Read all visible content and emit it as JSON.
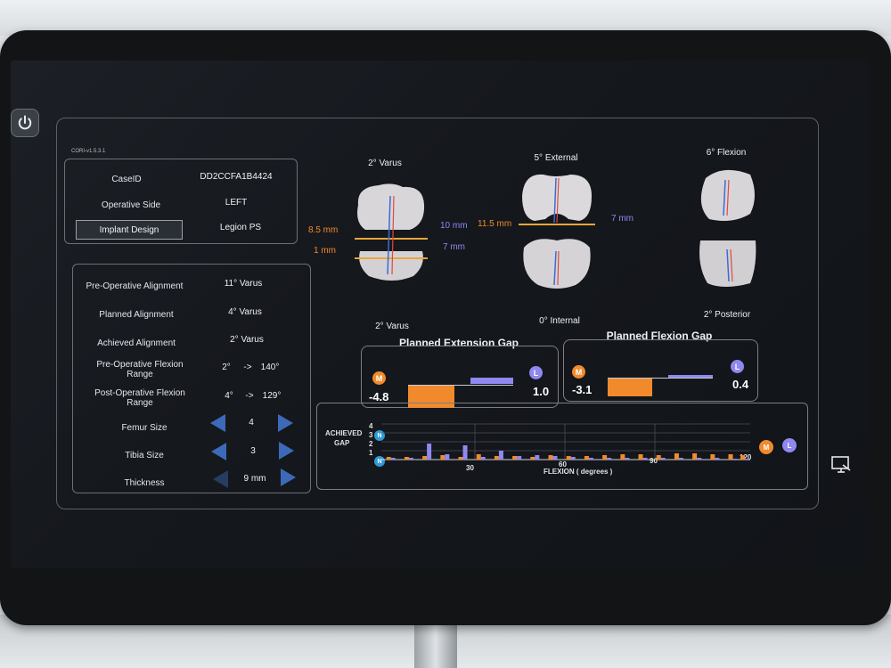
{
  "app": {
    "version": "CORI-v1.5.3.1"
  },
  "case_info": {
    "case_id_label": "CaseID",
    "case_id_value": "DD2CCFA1B4424",
    "operative_side_label": "Operative Side",
    "operative_side_value": "LEFT",
    "implant_design_label": "Implant Design",
    "implant_design_value": "Legion PS"
  },
  "alignment": {
    "pre_op_label": "Pre-Operative Alignment",
    "pre_op_value": "11° Varus",
    "planned_label": "Planned Alignment",
    "planned_value": "4° Varus",
    "achieved_label": "Achieved Alignment",
    "achieved_value": "2° Varus",
    "pre_flex_label": "Pre-Operative Flexion Range",
    "pre_flex_from": "2°",
    "pre_flex_arrow": "->",
    "pre_flex_to": "140°",
    "post_flex_label": "Post-Operative Flexion Range",
    "post_flex_from": "4°",
    "post_flex_arrow": "->",
    "post_flex_to": "129°",
    "femur_label": "Femur Size",
    "femur_value": "4",
    "tibia_label": "Tibia Size",
    "tibia_value": "3",
    "thickness_label": "Thickness",
    "thickness_value": "9 mm"
  },
  "views": {
    "coronal_top": "2° Varus",
    "coronal_bottom": "2° Varus",
    "axial_top": "5° External",
    "axial_bottom": "0° Internal",
    "sagittal_top": "6° Flexion",
    "sagittal_bottom": "2° Posterior",
    "meas_medial_top": "8.5 mm",
    "meas_medial_bottom": "1 mm",
    "meas_lateral_top": "10 mm",
    "meas_lateral_bottom": "7 mm",
    "meas_axial_medial": "11.5 mm",
    "meas_axial_lateral": "7 mm"
  },
  "extension_gap": {
    "title": "Planned Extension Gap",
    "medial_badge": "M",
    "lateral_badge": "L",
    "medial_value": "-4.8",
    "lateral_value": "1.0"
  },
  "flexion_gap": {
    "title": "Planned Flexion Gap",
    "medial_badge": "M",
    "lateral_badge": "L",
    "medial_value": "-3.1",
    "lateral_value": "0.4"
  },
  "achieved_chart": {
    "title_line1": "ACHIEVED",
    "title_line2": "GAP",
    "neutral_badge": "N",
    "y_ticks": [
      "4",
      "3",
      "2",
      "1"
    ],
    "x_ticks": [
      "30",
      "60",
      "90",
      "120"
    ],
    "x_label": "FLEXION  ( degrees )",
    "medial_badge": "M",
    "lateral_badge": "L"
  },
  "colors": {
    "medial": "#f08a2c",
    "lateral": "#8f88f0",
    "neutral": "#2f9bd6",
    "arrow": "#3c6ab8"
  },
  "chart_data": {
    "type": "bar",
    "x": [
      2,
      8,
      14,
      20,
      26,
      32,
      38,
      44,
      50,
      56,
      62,
      68,
      74,
      80,
      86,
      92,
      98,
      104,
      110,
      116,
      120
    ],
    "series": [
      {
        "name": "M",
        "values": [
          0.3,
          0.3,
          0.4,
          0.5,
          0.3,
          0.6,
          0.4,
          0.4,
          0.3,
          0.5,
          0.4,
          0.4,
          0.5,
          0.6,
          0.6,
          0.5,
          0.7,
          0.7,
          0.6,
          0.6,
          0.5
        ]
      },
      {
        "name": "L",
        "values": [
          0.2,
          0.2,
          1.8,
          0.6,
          1.6,
          0.3,
          1.0,
          0.4,
          0.5,
          0.4,
          0.3,
          0.2,
          0.2,
          0.2,
          0.2,
          0.2,
          0.2,
          0.2,
          0.2,
          0.1,
          0.1
        ]
      }
    ],
    "xlabel": "FLEXION  ( degrees )",
    "ylabel": "ACHIEVED GAP",
    "xlim": [
      0,
      120
    ],
    "ylim": [
      0,
      4
    ],
    "grid": true
  }
}
